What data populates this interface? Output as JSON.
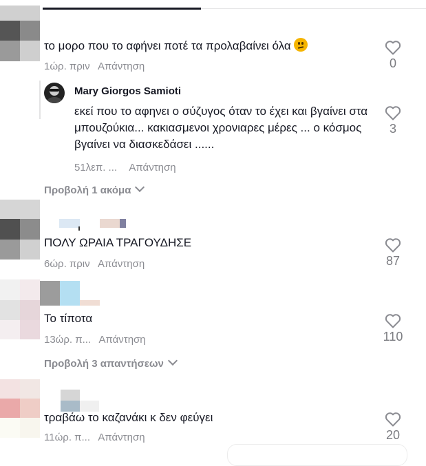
{
  "comments": [
    {
      "text": "το μορο που το αφήνει ποτέ τα προλαβαίνει όλα",
      "time": "1ώρ. πριν",
      "reply": "Απάντηση",
      "likes": "0",
      "emoji": "thinking-face-icon",
      "replies": [
        {
          "author": "Mary Giorgos Samioti",
          "text": "εκεί που το αφηνει ο σύζυγος όταν το έχει και βγαίνει στα μπουζούκια... κακιασμενοι χρονιαρες μέρες ... ο κόσμος βγαίνει να διασκεδάσει ......",
          "time": "51λεπ. ...",
          "reply": "Απάντηση",
          "likes": "3"
        }
      ],
      "view_more": "Προβολή 1 ακόμα"
    },
    {
      "text": "ΠΟΛΥ ΩΡΑΙΑ ΤΡΑΓΟΥΔΗΣΕ",
      "time": "6ώρ. πριν",
      "reply": "Απάντηση",
      "likes": "87"
    },
    {
      "text": "Το τίποτα",
      "time": "13ώρ. π...",
      "reply": "Απάντηση",
      "likes": "110",
      "view_more": "Προβολή 3 απαντήσεων"
    },
    {
      "text": "τραβάω το καζανάκι κ δεν φεύγει",
      "time": "11ώρ. π...",
      "reply": "Απάντηση",
      "likes": "20"
    }
  ],
  "colors": {
    "text": "#161823",
    "muted": "#8a8b91",
    "like_count": "#7b7c81"
  }
}
